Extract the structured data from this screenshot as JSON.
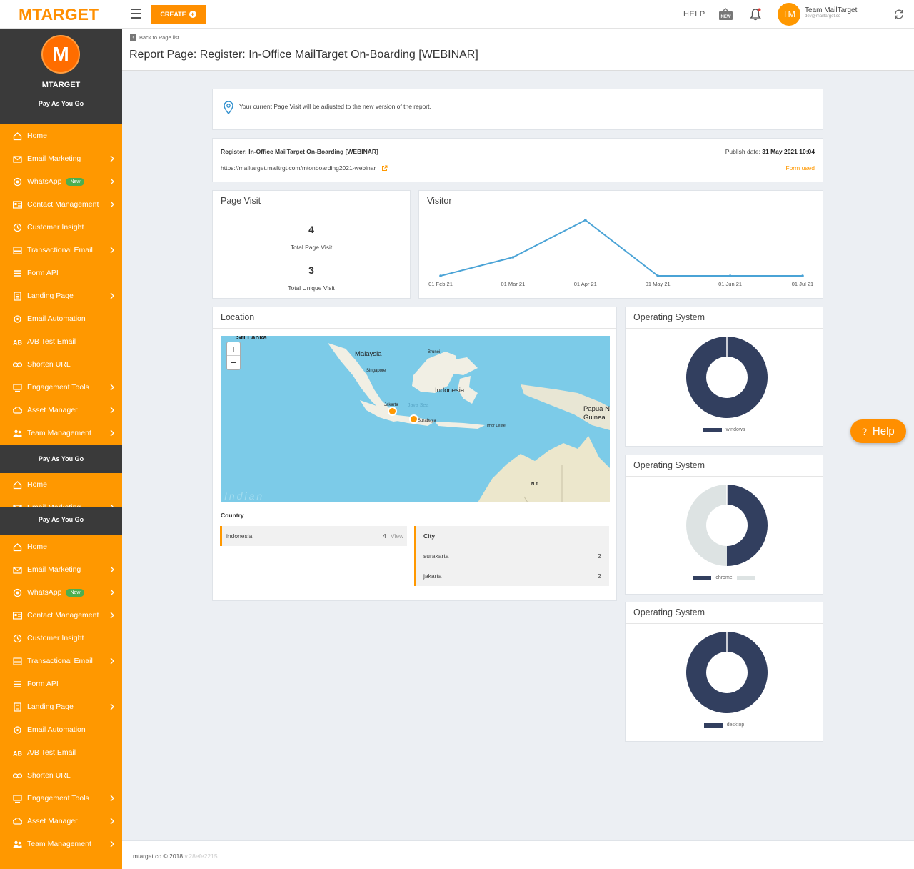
{
  "topbar": {
    "logo_text": "MTARGET",
    "create_label": "CREATE",
    "help_label": "HELP",
    "new_badge": "NEW",
    "avatar_initials": "TM",
    "user_name": "Team MailTarget",
    "user_email": "dev@mailtarget.co"
  },
  "sidebar": {
    "avatar_letter": "M",
    "brand": "MTARGET",
    "plan": "Pay As You Go",
    "items": [
      {
        "label": "Home",
        "icon": "home-icon",
        "chevron": false
      },
      {
        "label": "Email Marketing",
        "icon": "email-icon",
        "chevron": true
      },
      {
        "label": "WhatsApp",
        "icon": "whatsapp-icon",
        "chevron": true,
        "badge": "New"
      },
      {
        "label": "Contact Management",
        "icon": "contact-card-icon",
        "chevron": true
      },
      {
        "label": "Customer Insight",
        "icon": "insight-icon",
        "chevron": false
      },
      {
        "label": "Transactional Email",
        "icon": "transactional-icon",
        "chevron": true
      },
      {
        "label": "Form API",
        "icon": "form-icon",
        "chevron": false
      },
      {
        "label": "Landing Page",
        "icon": "landing-page-icon",
        "chevron": true
      },
      {
        "label": "Email Automation",
        "icon": "automation-icon",
        "chevron": false
      },
      {
        "label": "A/B Test Email",
        "icon": "ab-test-icon",
        "chevron": false
      },
      {
        "label": "Shorten URL",
        "icon": "link-icon",
        "chevron": false
      },
      {
        "label": "Engagement Tools",
        "icon": "engagement-icon",
        "chevron": true
      },
      {
        "label": "Asset Manager",
        "icon": "cloud-icon",
        "chevron": true
      },
      {
        "label": "Team Management",
        "icon": "team-icon",
        "chevron": true
      }
    ]
  },
  "header": {
    "back_label": "Back to Page list",
    "title": "Report Page: Register: In-Office MailTarget On-Boarding [WEBINAR]"
  },
  "notice": {
    "text": "Your current Page Visit will be adjusted to the new version of the report."
  },
  "register": {
    "title": "Register: In-Office MailTarget On-Boarding [WEBINAR]",
    "url": "https://mailtarget.mailtrgt.com/mtonboarding2021-webinar",
    "publish_label": "Publish date:",
    "publish_date": "31 May 2021 10:04",
    "form_used": "Form used"
  },
  "page_visit": {
    "title": "Page Visit",
    "total_page_visit": "4",
    "total_page_visit_label": "Total Page Visit",
    "total_unique_visit": "3",
    "total_unique_visit_label": "Total Unique Visit"
  },
  "chart_data": {
    "type": "line",
    "title": "Visitor",
    "categories": [
      "01 Feb 21",
      "01 Mar 21",
      "01 Apr 21",
      "01 May 21",
      "01 Jun 21",
      "01 Jul 21"
    ],
    "values": [
      0,
      1,
      3,
      0,
      0,
      0
    ],
    "ylim": [
      0,
      3
    ],
    "color": "#4aa3d6"
  },
  "location": {
    "title": "Location",
    "zoom_in": "+",
    "zoom_out": "−",
    "map_labels": {
      "sri_lanka": "Sri Lanka",
      "malaysia": "Malaysia",
      "brunei": "Brunei",
      "singapore": "Singapore",
      "indonesia": "Indonesia",
      "papua": "Papua N Guinea",
      "jakarta": "Jakarta",
      "java_sea": "Java Sea",
      "surabaya": "Surabaya",
      "timor": "Timor Leste",
      "nt": "N.T.",
      "indian": "Indian"
    },
    "country_header": "Country",
    "countries": [
      {
        "name": "indonesia",
        "count": "4",
        "action": "View"
      }
    ],
    "city_header": "City",
    "cities": [
      {
        "name": "surakarta",
        "count": "2"
      },
      {
        "name": "jakarta",
        "count": "2"
      }
    ]
  },
  "os_cards": [
    {
      "title": "Operating System",
      "legend": [
        "windows"
      ],
      "colors": [
        "#323f5f"
      ],
      "values": [
        1
      ]
    },
    {
      "title": "Operating System",
      "legend": [
        "chrome",
        ""
      ],
      "colors": [
        "#323f5f",
        "#dde3e3"
      ],
      "values": [
        0.5,
        0.5
      ]
    },
    {
      "title": "Operating System",
      "legend": [
        "desktop"
      ],
      "colors": [
        "#323f5f"
      ],
      "values": [
        1
      ]
    }
  ],
  "footer": {
    "copyright": "mtarget.co © 2018",
    "version": "v.28efe2215"
  },
  "help_button": "Help",
  "colors": {
    "brand_orange": "#ff9800",
    "sidebar_dark": "#3a3a3a",
    "donut_navy": "#323f5f"
  }
}
